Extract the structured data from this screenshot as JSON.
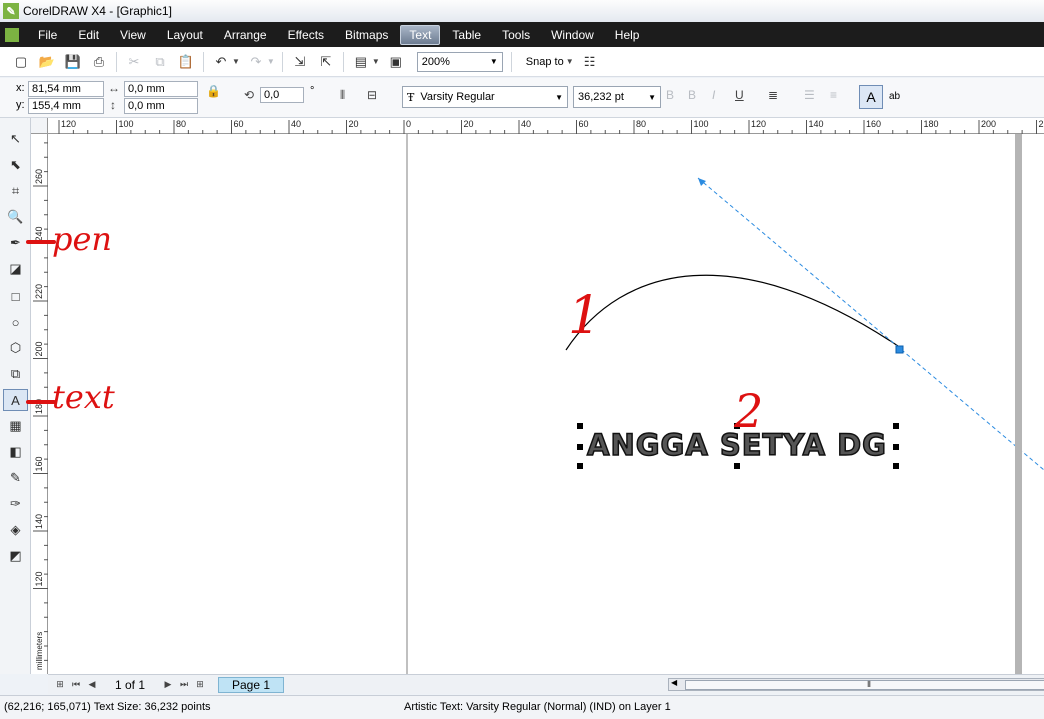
{
  "window": {
    "title": "CorelDRAW X4 - [Graphic1]"
  },
  "menu": [
    "File",
    "Edit",
    "View",
    "Layout",
    "Arrange",
    "Effects",
    "Bitmaps",
    "Text",
    "Table",
    "Tools",
    "Window",
    "Help"
  ],
  "menu_active": "Text",
  "toolbar": {
    "zoom": "200%",
    "snap_label": "Snap to"
  },
  "properties": {
    "x_label": "x:",
    "x_value": "81,54 mm",
    "y_label": "y:",
    "y_value": "155,4 mm",
    "width_value": "0,0 mm",
    "height_value": "0,0 mm",
    "rotation_value": "0,0",
    "rotation_unit": "°",
    "font_name": "Varsity Regular",
    "font_size": "36,232 pt",
    "text_mode_label": "ab"
  },
  "rulers": {
    "top_ticks": [
      "120",
      "100",
      "80",
      "60",
      "40",
      "20",
      "0",
      "20",
      "40",
      "60",
      "80",
      "100",
      "120",
      "140",
      "160",
      "180",
      "200",
      "22"
    ],
    "left_ticks": [
      "260",
      "240",
      "220",
      "200",
      "180",
      "160",
      "140",
      "120"
    ],
    "unit": "millimeters"
  },
  "canvas": {
    "text_object": "ANGGA SETYA DG",
    "annotation_1": "1",
    "annotation_2": "2",
    "label_pen": "pen",
    "label_text": "text"
  },
  "pagenav": {
    "page_of": "1 of 1",
    "page_tab": "Page 1"
  },
  "status": {
    "cursor": "(62,216; 165,071)",
    "text_size": "Text Size: 36,232 points",
    "object_info": "Artistic Text: Varsity Regular (Normal) (IND) on Layer 1"
  }
}
